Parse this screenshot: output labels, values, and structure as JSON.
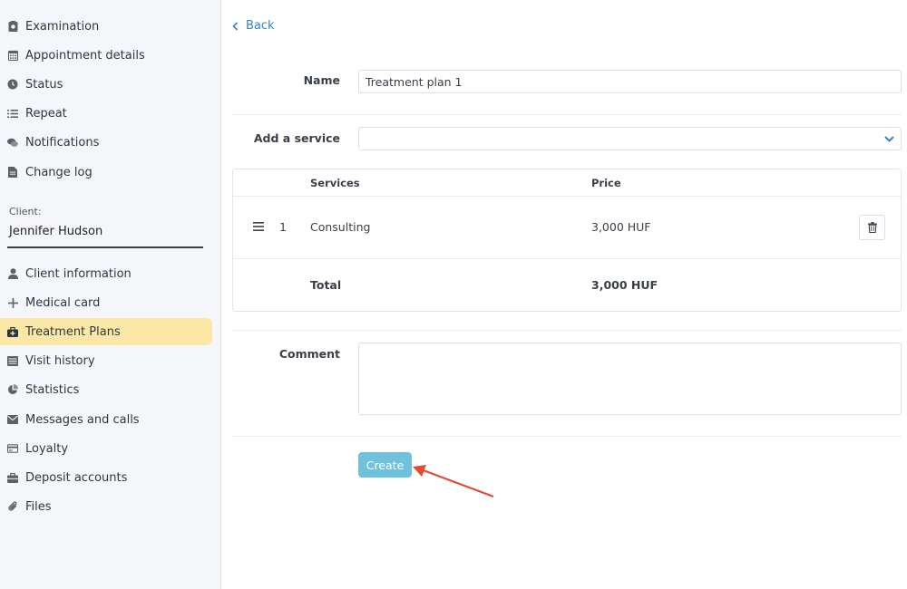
{
  "sidebar": {
    "top_items": [
      {
        "label": "Examination",
        "icon": "examination-icon"
      },
      {
        "label": "Appointment details",
        "icon": "calendar-icon"
      },
      {
        "label": "Status",
        "icon": "clock-icon"
      },
      {
        "label": "Repeat",
        "icon": "list-icon"
      },
      {
        "label": "Notifications",
        "icon": "chat-icon"
      },
      {
        "label": "Change log",
        "icon": "document-icon"
      }
    ],
    "client_caption": "Client:",
    "client_name": "Jennifer Hudson",
    "client_items": [
      {
        "label": "Client information",
        "icon": "user-icon"
      },
      {
        "label": "Medical card",
        "icon": "plus-icon"
      },
      {
        "label": "Treatment Plans",
        "icon": "briefcase-medical-icon",
        "active": true
      },
      {
        "label": "Visit history",
        "icon": "table-icon"
      },
      {
        "label": "Statistics",
        "icon": "pie-chart-icon"
      },
      {
        "label": "Messages and calls",
        "icon": "envelope-icon"
      },
      {
        "label": "Loyalty",
        "icon": "credit-card-icon"
      },
      {
        "label": "Deposit accounts",
        "icon": "briefcase-icon"
      },
      {
        "label": "Files",
        "icon": "paperclip-icon"
      }
    ],
    "active_color": "#fbe8a6"
  },
  "main": {
    "back_label": "Back",
    "name_label": "Name",
    "name_value": "Treatment plan 1",
    "add_service_label": "Add a service",
    "add_service_value": "",
    "table": {
      "headers": {
        "services": "Services",
        "price": "Price"
      },
      "rows": [
        {
          "index": "1",
          "service": "Consulting",
          "price": "3,000 HUF"
        }
      ],
      "total_label": "Total",
      "total_value": "3,000 HUF"
    },
    "comment_label": "Comment",
    "comment_value": "",
    "create_label": "Create",
    "accent_color": "#6fc1dc",
    "link_color": "#3b82c4",
    "annotation_arrow_color": "#e24a33"
  }
}
